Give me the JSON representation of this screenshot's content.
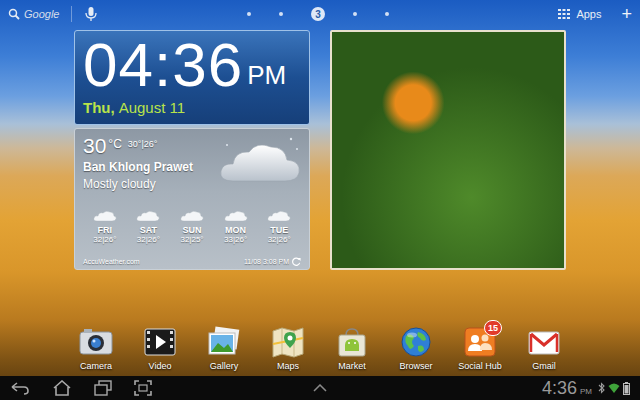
{
  "top_bar": {
    "search_label": "Google",
    "page_dots": [
      {
        "selected": false
      },
      {
        "selected": false
      },
      {
        "selected": true,
        "label": "3"
      },
      {
        "selected": false
      },
      {
        "selected": false
      }
    ],
    "apps_label": "Apps",
    "add_label": "+"
  },
  "clock": {
    "time": "04:36",
    "ampm": "PM",
    "day": "Thu,",
    "date": "August 11"
  },
  "weather": {
    "temp": "30",
    "unit": "°C",
    "range": "30°|26°",
    "location": "Ban Khlong Prawet",
    "condition": "Mostly cloudy",
    "forecast": [
      {
        "day": "FRI",
        "range": "32|26°"
      },
      {
        "day": "SAT",
        "range": "32|26°"
      },
      {
        "day": "SUN",
        "range": "32|25°"
      },
      {
        "day": "MON",
        "range": "33|26°"
      },
      {
        "day": "TUE",
        "range": "32|26°"
      }
    ],
    "source": "AccuWeather.com",
    "updated": "11/08 3:08 PM"
  },
  "dock": [
    {
      "label": "Camera"
    },
    {
      "label": "Video"
    },
    {
      "label": "Gallery"
    },
    {
      "label": "Maps"
    },
    {
      "label": "Market"
    },
    {
      "label": "Browser"
    },
    {
      "label": "Social Hub",
      "badge": "15"
    },
    {
      "label": "Gmail"
    }
  ],
  "system_bar": {
    "time": "4:36",
    "ampm": "PM"
  }
}
